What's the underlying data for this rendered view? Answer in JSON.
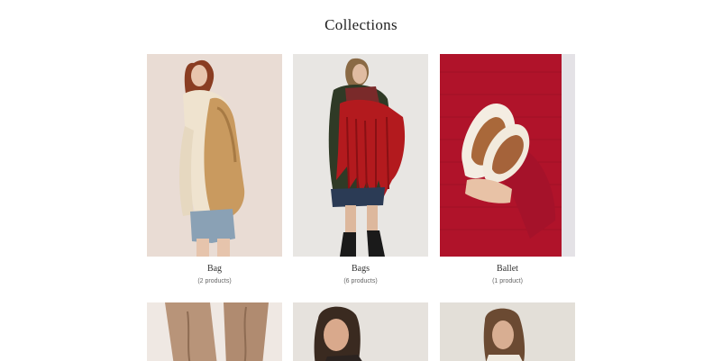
{
  "page": {
    "title": "Collections"
  },
  "collections": [
    {
      "title": "Bag",
      "count": "(2 products)",
      "image": "woman-with-tan-leather-backpack"
    },
    {
      "title": "Bags",
      "count": "(6 products)",
      "image": "woman-with-red-fringe-bag"
    },
    {
      "title": "Ballet",
      "count": "(1 product)",
      "image": "sherpa-ballet-flats-on-red-sweater"
    },
    {
      "image": "tan-suede-pants"
    },
    {
      "image": "woman-with-dark-hair-portrait"
    },
    {
      "image": "woman-with-curly-hair-portrait"
    }
  ]
}
